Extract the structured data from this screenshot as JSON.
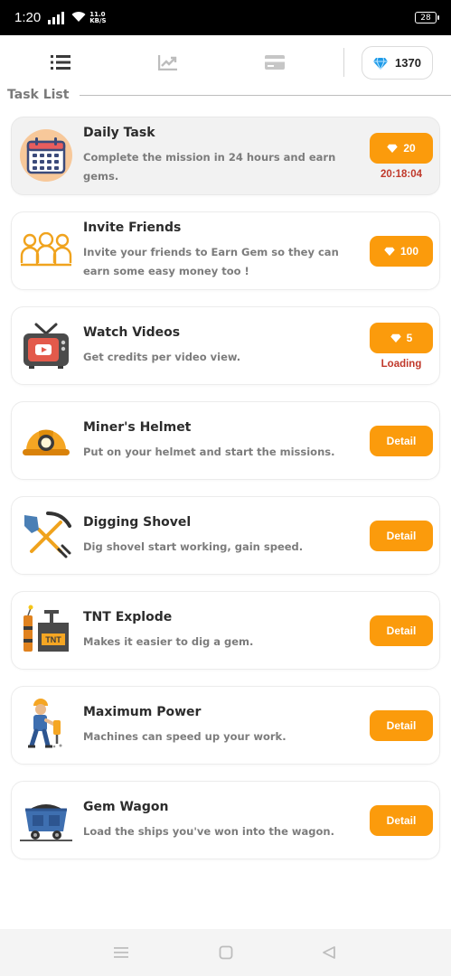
{
  "status_bar": {
    "time": "1:20",
    "speed_value": "11.0",
    "speed_unit": "KB/S",
    "battery": "28"
  },
  "nav": {
    "tabs": [
      {
        "icon": "list-icon",
        "active": true
      },
      {
        "icon": "chart-icon",
        "active": false
      },
      {
        "icon": "card-icon",
        "active": false
      }
    ],
    "gem_balance": "1370",
    "gem_icon": "diamond-icon"
  },
  "section": {
    "title": "Task List"
  },
  "tasks": [
    {
      "title": "Daily Task",
      "description": "Complete the mission in 24 hours and earn gems.",
      "icon": "calendar-icon",
      "reward": "20",
      "status": "20:18:04"
    },
    {
      "title": "Invite Friends",
      "description": "Invite your friends to Earn Gem so they can earn some easy money too !",
      "icon": "group-icon",
      "reward": "100",
      "status": ""
    },
    {
      "title": "Watch Videos",
      "description": "Get credits per video view.",
      "icon": "tv-icon",
      "reward": "5",
      "status": "Loading"
    },
    {
      "title": "Miner's Helmet",
      "description": "Put on your helmet and start the missions.",
      "icon": "helmet-icon",
      "button": "Detail"
    },
    {
      "title": "Digging Shovel",
      "description": "Dig shovel start working, gain speed.",
      "icon": "shovel-pickaxe-icon",
      "button": "Detail"
    },
    {
      "title": "TNT Explode",
      "description": "Makes it easier to dig a gem.",
      "icon": "tnt-icon",
      "icon_label": "TNT",
      "button": "Detail"
    },
    {
      "title": "Maximum Power",
      "description": "Machines can speed up your work.",
      "icon": "jackhammer-worker-icon",
      "button": "Detail"
    },
    {
      "title": "Gem Wagon",
      "description": "Load the ships you've won into the wagon.",
      "icon": "mine-cart-icon",
      "button": "Detail"
    }
  ],
  "colors": {
    "accent": "#fb9b0c",
    "timer": "#c0392b",
    "gem": "#1e9be8"
  },
  "system_nav": [
    "menu-icon",
    "home-icon",
    "back-icon"
  ]
}
